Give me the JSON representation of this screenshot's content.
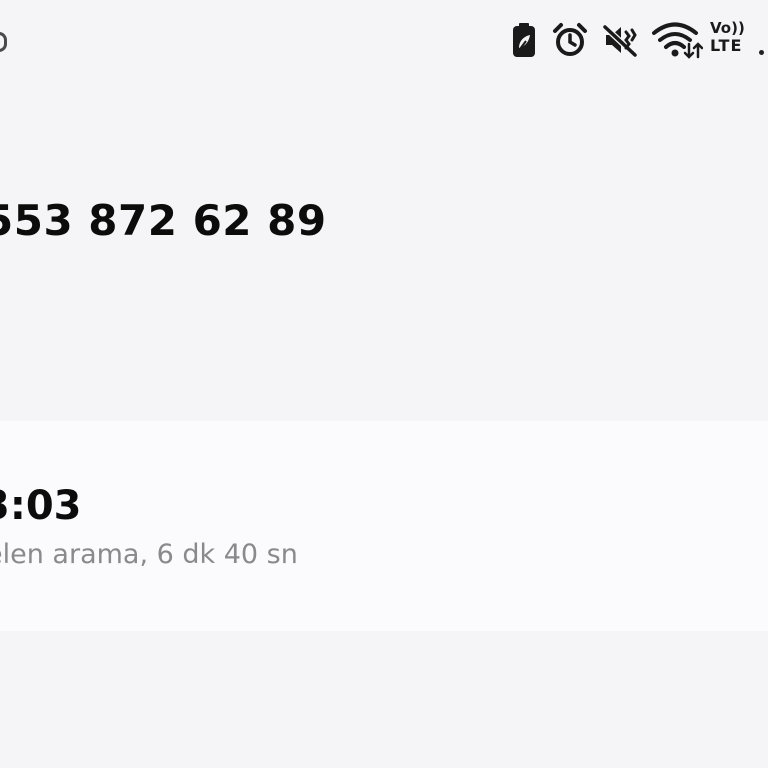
{
  "status_bar": {
    "icons": [
      "battery-saver-icon",
      "alarm-icon",
      "mute-icon",
      "wifi-icon",
      "volte-icon"
    ],
    "volte_top": "Vo))",
    "volte_bottom": "LTE"
  },
  "contact": {
    "number": "553 872 62 89"
  },
  "call_entry": {
    "time": "3:03",
    "detail": "elen arama, 6 dk 40 sn"
  },
  "colors": {
    "background": "#f5f5f7",
    "card": "#fbfbfd",
    "primary_text": "#0c0c0c",
    "secondary_text": "#8a8a8c"
  }
}
